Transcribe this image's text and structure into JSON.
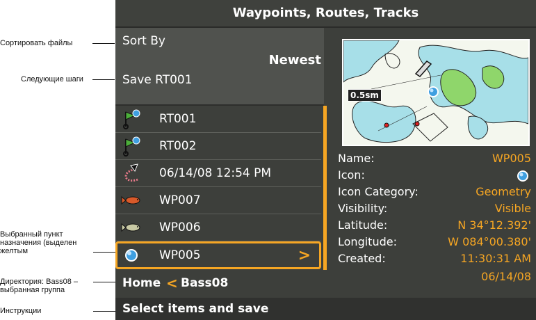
{
  "annotations": [
    {
      "text": "Сортировать файлы"
    },
    {
      "text": "Следующие шаги"
    },
    {
      "text": "Выбранный пункт назначения (выделен желтым"
    },
    {
      "text": "Директория: Bass08 – выбранная группа"
    },
    {
      "text": "Инструкции"
    }
  ],
  "title": "Waypoints, Routes, Tracks",
  "sort": {
    "label": "Sort By",
    "value": "Newest"
  },
  "save_label": "Save RT001",
  "items": [
    {
      "label": "RT001",
      "icon": "route-flag-icon"
    },
    {
      "label": "RT002",
      "icon": "route-flag-icon"
    },
    {
      "label": "06/14/08 12:54 PM",
      "icon": "track-icon"
    },
    {
      "label": "WP007",
      "icon": "fish-icon"
    },
    {
      "label": "WP006",
      "icon": "fish-icon"
    },
    {
      "label": "WP005",
      "icon": "waypoint-sphere-icon",
      "selected": true
    }
  ],
  "breadcrumb": {
    "home": "Home",
    "group": "Bass08"
  },
  "instructions": "Select items and save",
  "map": {
    "scale": "0.5sm"
  },
  "details": {
    "name_key": "Name:",
    "name_val": "WP005",
    "icon_key": "Icon:",
    "category_key": "Icon Category:",
    "category_val": "Geometry",
    "visibility_key": "Visibility:",
    "visibility_val": "Visible",
    "latitude_key": "Latitude:",
    "latitude_val": "N 34°12.392'",
    "longitude_key": "Longitude:",
    "longitude_val": "W 084°00.380'",
    "created_key": "Created:",
    "created_time": "11:30:31 AM",
    "created_date": "06/14/08"
  },
  "colors": {
    "accent": "#f6a623",
    "background": "#3d3f3b"
  }
}
